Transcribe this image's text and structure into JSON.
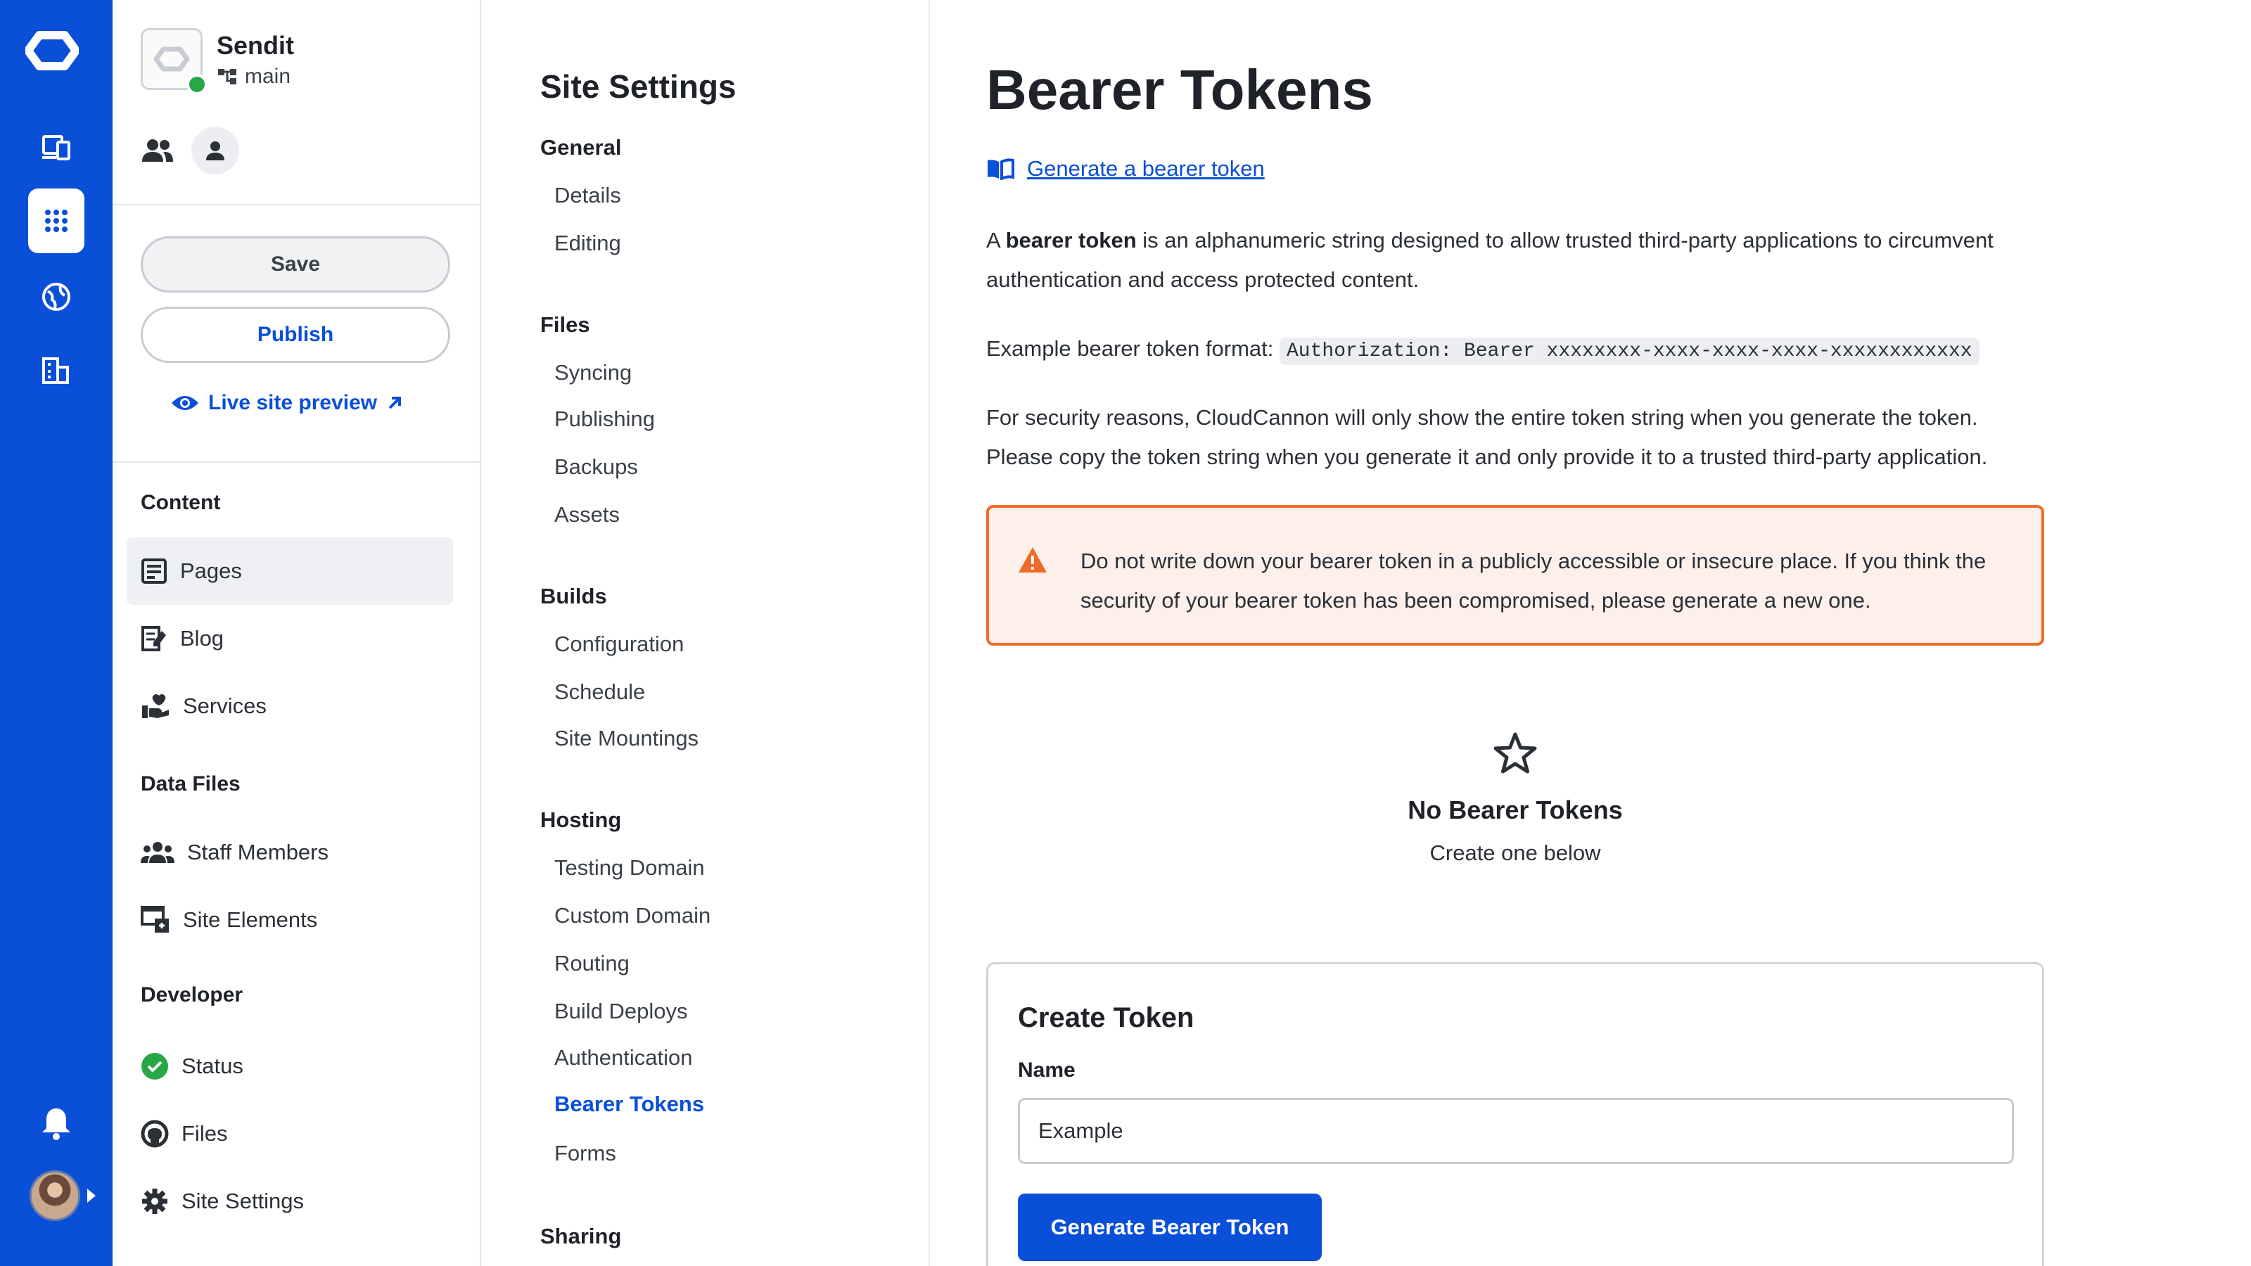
{
  "rail": {
    "icons": [
      "cloudcannon-logo-icon",
      "devices-icon",
      "apps-grid-icon",
      "globe-icon",
      "organization-icon",
      "bell-icon",
      "user-avatar"
    ],
    "active": "apps-grid-icon"
  },
  "site": {
    "name": "Sendit",
    "branch": "main",
    "status": "ok"
  },
  "actions": {
    "save": "Save",
    "publish": "Publish",
    "preview": "Live site preview"
  },
  "sidebar": {
    "content_heading": "Content",
    "content_items": [
      {
        "label": "Pages",
        "icon": "pages-icon",
        "active": true
      },
      {
        "label": "Blog",
        "icon": "blog-icon"
      },
      {
        "label": "Services",
        "icon": "services-icon"
      }
    ],
    "data_heading": "Data Files",
    "data_items": [
      {
        "label": "Staff Members",
        "icon": "people-icon"
      },
      {
        "label": "Site Elements",
        "icon": "site-elements-icon"
      }
    ],
    "dev_heading": "Developer",
    "dev_items": [
      {
        "label": "Status",
        "icon": "status-check-icon"
      },
      {
        "label": "Files",
        "icon": "github-icon"
      },
      {
        "label": "Site Settings",
        "icon": "gear-icon"
      }
    ]
  },
  "settings": {
    "title": "Site Settings",
    "groups": [
      {
        "label": "General",
        "links": [
          "Details",
          "Editing"
        ]
      },
      {
        "label": "Files",
        "links": [
          "Syncing",
          "Publishing",
          "Backups",
          "Assets"
        ]
      },
      {
        "label": "Builds",
        "links": [
          "Configuration",
          "Schedule",
          "Site Mountings"
        ]
      },
      {
        "label": "Hosting",
        "links": [
          "Testing Domain",
          "Custom Domain",
          "Routing",
          "Build Deploys",
          "Authentication",
          "Bearer Tokens",
          "Forms"
        ]
      },
      {
        "label": "Sharing",
        "links": []
      }
    ],
    "current": "Bearer Tokens"
  },
  "main": {
    "title": "Bearer Tokens",
    "doc_link": "Generate a bearer token",
    "intro_prefix": "A ",
    "intro_bold": "bearer token",
    "intro_rest": " is an alphanumeric string designed to allow trusted third-party applications to circumvent authentication and access protected content.",
    "format_label": "Example bearer token format: ",
    "format_code": "Authorization: Bearer xxxxxxxx-xxxx-xxxx-xxxx-xxxxxxxxxxxx",
    "security_note": "For security reasons, CloudCannon will only show the entire token string when you generate the token. Please copy the token string when you generate it and only provide it to a trusted third-party application.",
    "warning": "Do not write down your bearer token in a publicly accessible or insecure place. If you think the security of your bearer token has been compromised, please generate a new one.",
    "empty_title": "No Bearer Tokens",
    "empty_sub": "Create one below",
    "card_title": "Create Token",
    "name_label": "Name",
    "name_value": "Example",
    "generate_button": "Generate Bearer Token"
  },
  "colors": {
    "brand": "#0a4fd8",
    "warning_border": "#f06a2a",
    "warning_bg": "#fdefe9",
    "success": "#28a745"
  }
}
